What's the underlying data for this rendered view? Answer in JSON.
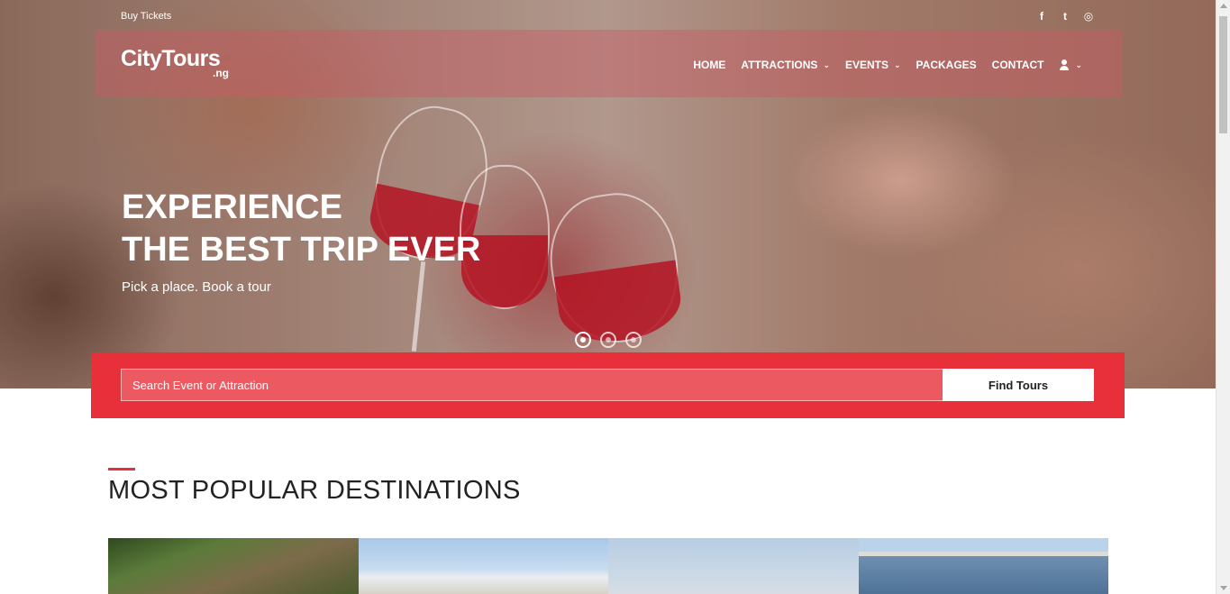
{
  "topbar": {
    "buy_tickets": "Buy Tickets",
    "social": [
      {
        "icon": "facebook-icon",
        "glyph": "f"
      },
      {
        "icon": "twitter-icon",
        "glyph": "t"
      },
      {
        "icon": "instagram-icon",
        "glyph": "◎"
      }
    ]
  },
  "brand": {
    "name": "CityTours",
    "suffix": ".ng"
  },
  "nav": {
    "home": "HOME",
    "attractions": "ATTRACTIONS",
    "events": "EVENTS",
    "packages": "PACKAGES",
    "contact": "CONTACT",
    "chevron": "⌄"
  },
  "hero": {
    "line1": "EXPERIENCE",
    "line2": "THE BEST TRIP EVER",
    "tagline": "Pick a place. Book a tour",
    "slides_count": 3,
    "active_slide": 1
  },
  "search": {
    "placeholder": "Search Event or Attraction",
    "button_label": "Find Tours"
  },
  "section": {
    "title": "MOST POPULAR DESTINATIONS"
  },
  "colors": {
    "accent": "#e8303a",
    "navbar_overlay": "rgba(200,90,100,0.45)",
    "text_dark": "#222222",
    "white": "#ffffff"
  }
}
